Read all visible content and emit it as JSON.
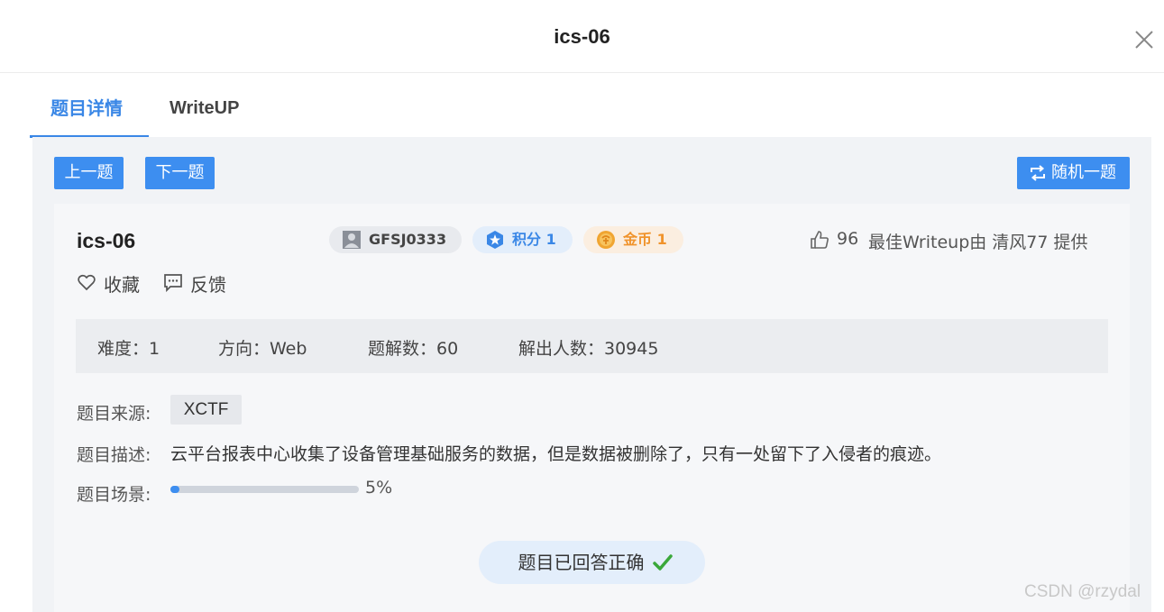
{
  "dialog": {
    "title": "ics-06"
  },
  "tabs": [
    {
      "label": "题目详情",
      "active": true
    },
    {
      "label": "WriteUP",
      "active": false
    }
  ],
  "nav": {
    "prev_label": "上一题",
    "next_label": "下一题",
    "random_label": "随机一题"
  },
  "challenge": {
    "name": "ics-06",
    "badges": {
      "id": "GFSJ0333",
      "score": "积分 1",
      "gold": "金币 1"
    },
    "likes": "96",
    "writeup_credit": "最佳Writeup由 清风77 提供",
    "actions": {
      "favorite": "收藏",
      "feedback": "反馈"
    },
    "stats": {
      "difficulty": "难度：1",
      "direction": "方向：Web",
      "solves": "题解数：60",
      "solvers": "解出人数：30945"
    },
    "source_label": "题目来源:",
    "source": "XCTF",
    "desc_label": "题目描述:",
    "description": "云平台报表中心收集了设备管理基础服务的数据，但是数据被删除了，只有一处留下了入侵者的痕迹。",
    "scene_label": "题目场景:",
    "scene_progress": 5,
    "scene_progress_text": "5%",
    "status": "题目已回答正确"
  },
  "colors": {
    "accent": "#3d8ef0",
    "gold": "#f0932b",
    "success": "#3aa83a"
  },
  "icons": [
    "close-icon",
    "swap-icon",
    "avatar-icon",
    "star-shield-icon",
    "coin-icon",
    "thumbs-up-icon",
    "heart-icon",
    "feedback-icon",
    "check-icon"
  ],
  "watermark": "CSDN @rzydal"
}
